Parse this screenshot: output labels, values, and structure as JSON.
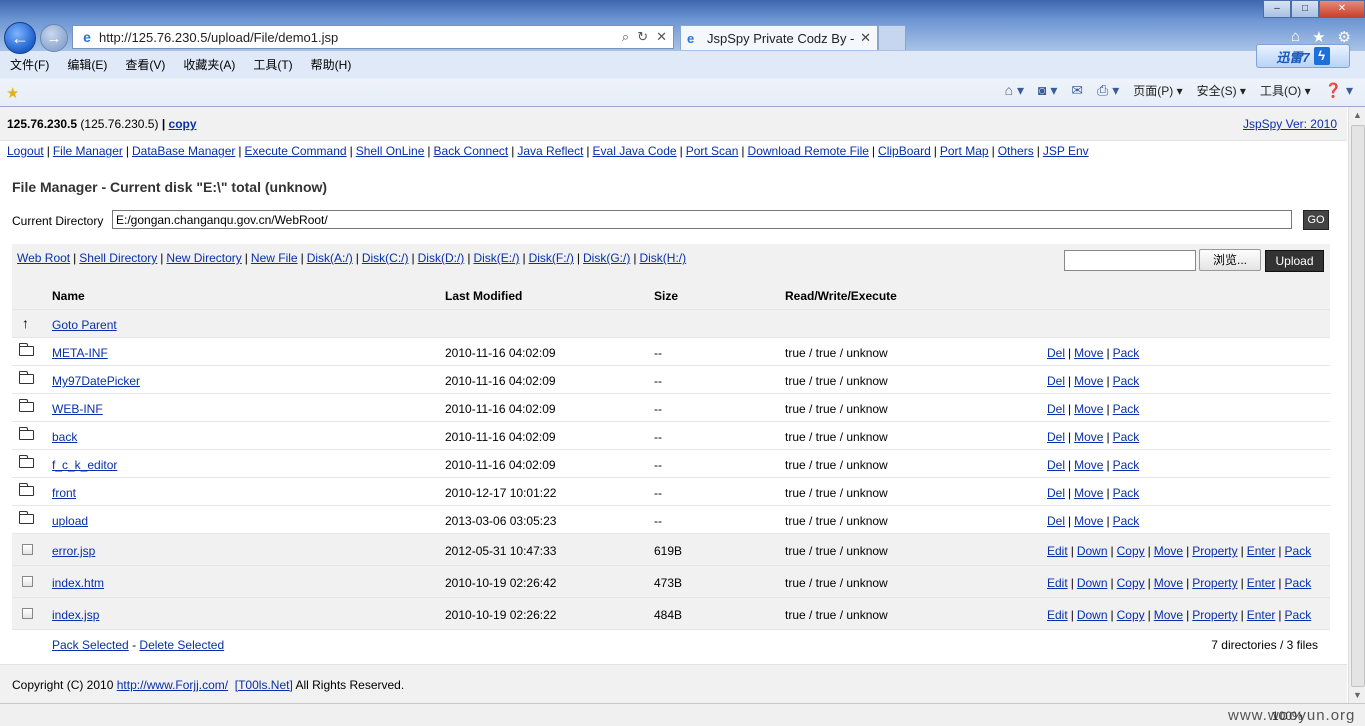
{
  "browser": {
    "url": "http://125.76.230.5/upload/File/demo1.jsp",
    "tab_title": "JspSpy Private Codz By -...",
    "menu": [
      "文件(F)",
      "编辑(E)",
      "查看(V)",
      "收藏夹(A)",
      "工具(T)",
      "帮助(H)"
    ],
    "xunlei_label": "迅雷7",
    "cmdbar": {
      "page": "页面(P)",
      "safety": "安全(S)",
      "tools": "工具(O)"
    },
    "zoom": "100%",
    "watermark": "www.wooyun.org"
  },
  "header": {
    "host_ip": "125.76.230.5",
    "host_paren": "(125.76.230.5)",
    "copy_label": "copy",
    "version": "JspSpy Ver: 2010"
  },
  "toolnav": [
    "Logout",
    "File Manager",
    "DataBase Manager",
    "Execute Command",
    "Shell OnLine",
    "Back Connect",
    "Java Reflect",
    "Eval Java Code",
    "Port Scan",
    "Download Remote File",
    "ClipBoard",
    "Port Map",
    "Others",
    "JSP Env"
  ],
  "file_manager": {
    "title": "File Manager - Current disk \"E:\\\" total (unknow)",
    "current_dir_label": "Current Directory",
    "current_dir_value": "E:/gongan.changanqu.gov.cn/WebRoot/",
    "go_label": "GO",
    "quick_links": [
      "Web Root",
      "Shell Directory",
      "New Directory",
      "New File",
      "Disk(A:/)",
      "Disk(C:/)",
      "Disk(D:/)",
      "Disk(E:/)",
      "Disk(F:/)",
      "Disk(G:/)",
      "Disk(H:/)"
    ],
    "browse_label": "浏览...",
    "upload_label": "Upload",
    "columns": {
      "name": "Name",
      "modified": "Last Modified",
      "size": "Size",
      "perm": "Read/Write/Execute"
    },
    "goto_parent": "Goto Parent",
    "directories": [
      {
        "name": "META-INF",
        "modified": "2010-11-16 04:02:09",
        "size": "--",
        "perm": "true / true / unknow"
      },
      {
        "name": "My97DatePicker",
        "modified": "2010-11-16 04:02:09",
        "size": "--",
        "perm": "true / true / unknow"
      },
      {
        "name": "WEB-INF",
        "modified": "2010-11-16 04:02:09",
        "size": "--",
        "perm": "true / true / unknow"
      },
      {
        "name": "back",
        "modified": "2010-11-16 04:02:09",
        "size": "--",
        "perm": "true / true / unknow"
      },
      {
        "name": "f_c_k_editor",
        "modified": "2010-11-16 04:02:09",
        "size": "--",
        "perm": "true / true / unknow"
      },
      {
        "name": "front",
        "modified": "2010-12-17 10:01:22",
        "size": "--",
        "perm": "true / true / unknow"
      },
      {
        "name": "upload",
        "modified": "2013-03-06 03:05:23",
        "size": "--",
        "perm": "true / true / unknow"
      }
    ],
    "dir_actions": [
      "Del",
      "Move",
      "Pack"
    ],
    "files": [
      {
        "name": "error.jsp",
        "modified": "2012-05-31 10:47:33",
        "size": "619B",
        "perm": "true / true / unknow"
      },
      {
        "name": "index.htm",
        "modified": "2010-10-19 02:26:42",
        "size": "473B",
        "perm": "true / true / unknow"
      },
      {
        "name": "index.jsp",
        "modified": "2010-10-19 02:26:22",
        "size": "484B",
        "perm": "true / true / unknow"
      }
    ],
    "file_actions": [
      "Edit",
      "Down",
      "Copy",
      "Move",
      "Property",
      "Enter",
      "Pack"
    ],
    "pack_selected": "Pack Selected",
    "delete_selected": "Delete Selected",
    "summary": "7 directories / 3 files"
  },
  "copyright": {
    "prefix": "Copyright (C) 2010",
    "link1": "http://www.Forjj.com/",
    "link2": "[T00ls.Net]",
    "suffix": "All Rights Reserved."
  }
}
